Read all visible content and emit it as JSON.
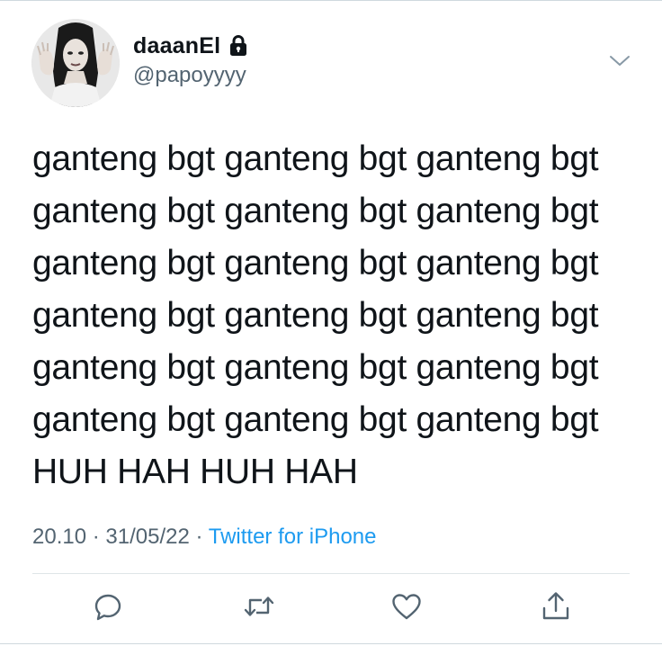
{
  "author": {
    "display_name": "daaanEl",
    "handle": "@papoyyyy",
    "avatar_icon": "avatar-photo",
    "protected_icon": "lock-icon"
  },
  "tweet": {
    "lines": [
      "ganteng bgt ganteng bgt ganteng bgt",
      "ganteng bgt ganteng bgt ganteng bgt",
      "ganteng bgt ganteng bgt ganteng bgt",
      "ganteng bgt ganteng bgt ganteng bgt",
      "ganteng bgt ganteng bgt ganteng bgt",
      "ganteng bgt ganteng bgt ganteng bgt",
      "HUH HAH HUH HAH"
    ],
    "time": "20.10",
    "separator": "·",
    "date": "31/05/22",
    "source": "Twitter for iPhone"
  },
  "actions": {
    "reply_icon": "reply-icon",
    "retweet_icon": "retweet-icon",
    "like_icon": "heart-icon",
    "share_icon": "share-icon"
  },
  "colors": {
    "text": "#0f1419",
    "secondary": "#536471",
    "link": "#1d9bf0",
    "rule": "#cfd9de"
  }
}
